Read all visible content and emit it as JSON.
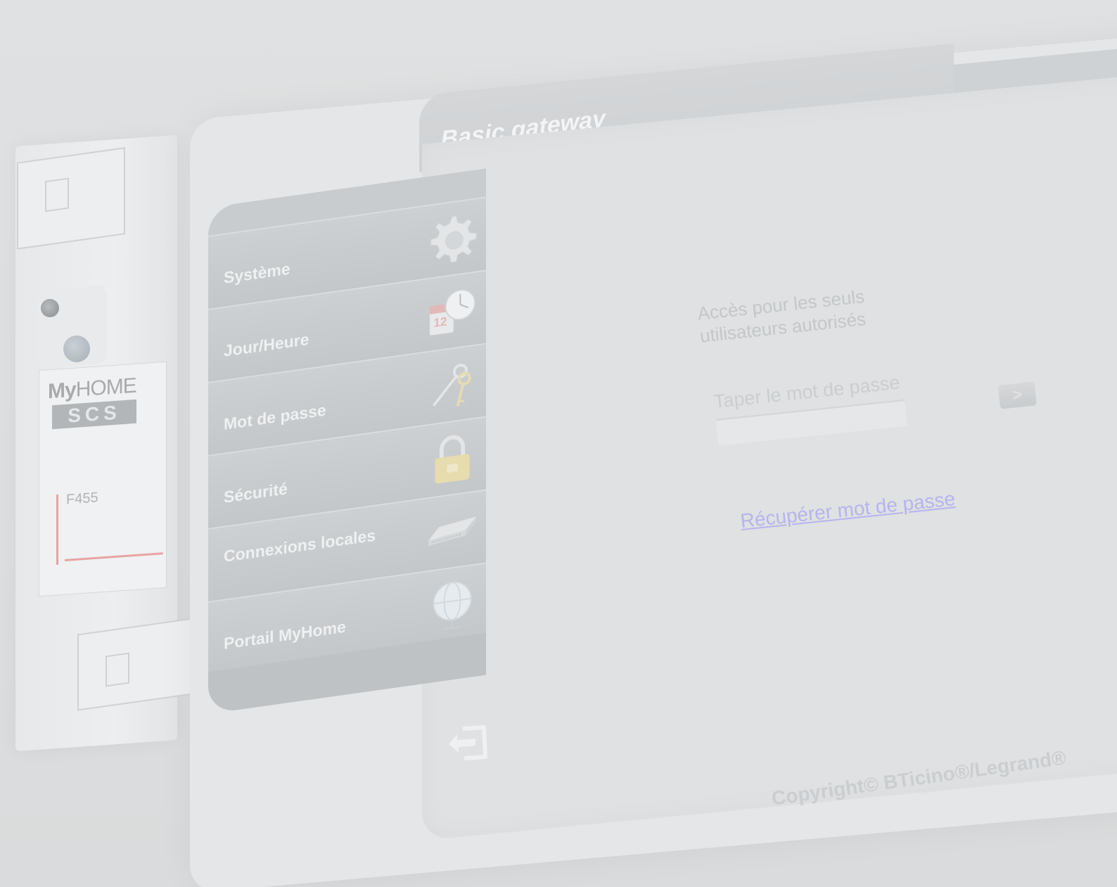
{
  "app": {
    "title": "Basic gateway"
  },
  "device": {
    "brand_my": "My",
    "brand_home": "HOME",
    "brand_scs": "SCS",
    "model": "F455"
  },
  "sidebar": {
    "items": [
      {
        "label": "Système",
        "icon": "gear-icon"
      },
      {
        "label": "Jour/Heure",
        "icon": "calendar-clock-icon"
      },
      {
        "label": "Mot de passe",
        "icon": "keys-icon"
      },
      {
        "label": "Sécurité",
        "icon": "padlock-icon"
      },
      {
        "label": "Connexions locales",
        "icon": "network-switch-icon"
      },
      {
        "label": "Portail MyHome",
        "icon": "globe-icon"
      }
    ]
  },
  "login": {
    "access_message": "Accès pour les seuls utilisateurs autorisés",
    "password_label": "Taper le mot de passe",
    "password_value": "",
    "submit_symbol": ">",
    "recover_link": "Récupérer mot de passe"
  },
  "footer": {
    "copyright": "Copyright© BTicino®/Legrand®"
  },
  "colors": {
    "background": "#dcdedf",
    "sidebar": "#c9ccce",
    "link": "#b6b4ee",
    "device_accent_line": "#e8a3a3"
  }
}
